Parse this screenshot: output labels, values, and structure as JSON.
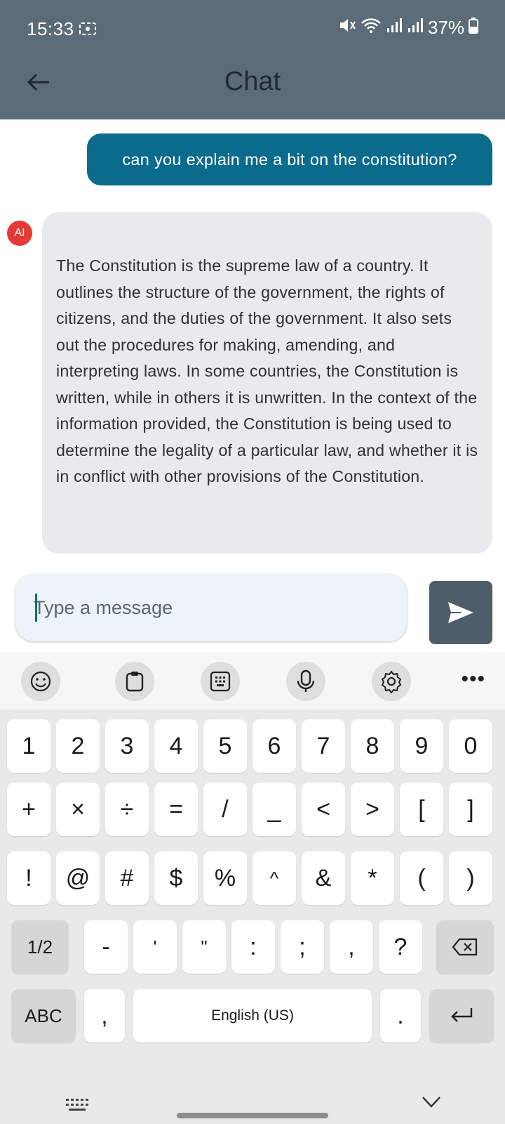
{
  "status_bar": {
    "time": "15:33",
    "battery": "37%"
  },
  "header": {
    "title": "Chat",
    "back_icon": "arrow-left-icon"
  },
  "messages": [
    {
      "role": "user",
      "text": "can you explain me a bit on the constitution?"
    },
    {
      "role": "ai",
      "avatar": "AI",
      "text": "The Constitution is the supreme law of a country. It outlines the structure of the government, the rights of citizens, and the duties of the government. It also sets out the procedures for making, amending, and interpreting laws. In some countries, the Constitution is written, while in others it is unwritten. In the context of the information provided, the Constitution is being used to determine the legality of a particular law, and whether it is in conflict with other provisions of the Constitution."
    }
  ],
  "input": {
    "placeholder": "Type a message",
    "value": ""
  },
  "keyboard": {
    "toolbar": [
      "emoji-icon",
      "clipboard-icon",
      "keypad-icon",
      "microphone-icon",
      "settings-icon",
      "more-icon"
    ],
    "row1": [
      "1",
      "2",
      "3",
      "4",
      "5",
      "6",
      "7",
      "8",
      "9",
      "0"
    ],
    "row2": [
      "+",
      "×",
      "÷",
      "=",
      "/",
      "_",
      "<",
      ">",
      "[",
      "]"
    ],
    "row3": [
      "!",
      "@",
      "#",
      "$",
      "%",
      "^",
      "&",
      "*",
      "(",
      ")"
    ],
    "row4": [
      "1/2",
      "-",
      "'",
      "\"",
      ":",
      ";",
      ",",
      "?"
    ],
    "row5": {
      "abc": "ABC",
      "comma": ",",
      "space": "English (US)",
      "period": "."
    }
  },
  "colors": {
    "header": "#5b6c78",
    "user_bubble": "#0b6b8c",
    "ai_bubble": "#e9eaed",
    "avatar": "#e53935",
    "send_button": "#4d5d69"
  }
}
